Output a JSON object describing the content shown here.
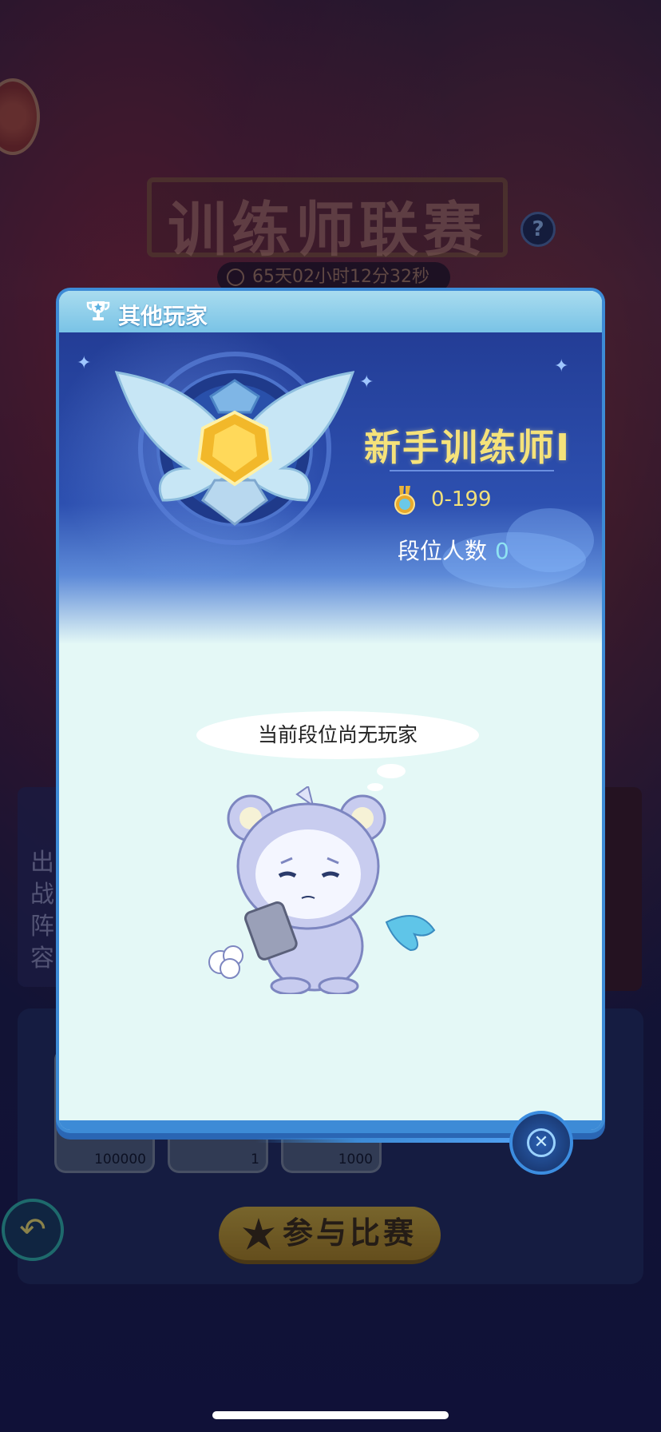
{
  "background": {
    "title": "训练师联赛",
    "help": "?",
    "timer": "65天02小时12分32秒",
    "lineup_label": "出战阵容",
    "items": [
      {
        "count": "100000"
      },
      {
        "count": "1"
      },
      {
        "count": "1000"
      }
    ],
    "join_button": "参与比赛"
  },
  "modal": {
    "title": "其他玩家",
    "rank_name": "新手训练师I",
    "score_range": "0-199",
    "players_label": "段位人数",
    "players_count": "0",
    "empty_message": "当前段位尚无玩家"
  },
  "colors": {
    "header": "#79c3e6",
    "accent": "#3d8bd6",
    "rank_gold": "#f5e27a",
    "panel_bg": "#e4f8f6"
  },
  "icons": [
    "trophy-icon",
    "medal-icon",
    "close-icon",
    "back-arrow-icon",
    "help-icon",
    "timer-icon"
  ]
}
